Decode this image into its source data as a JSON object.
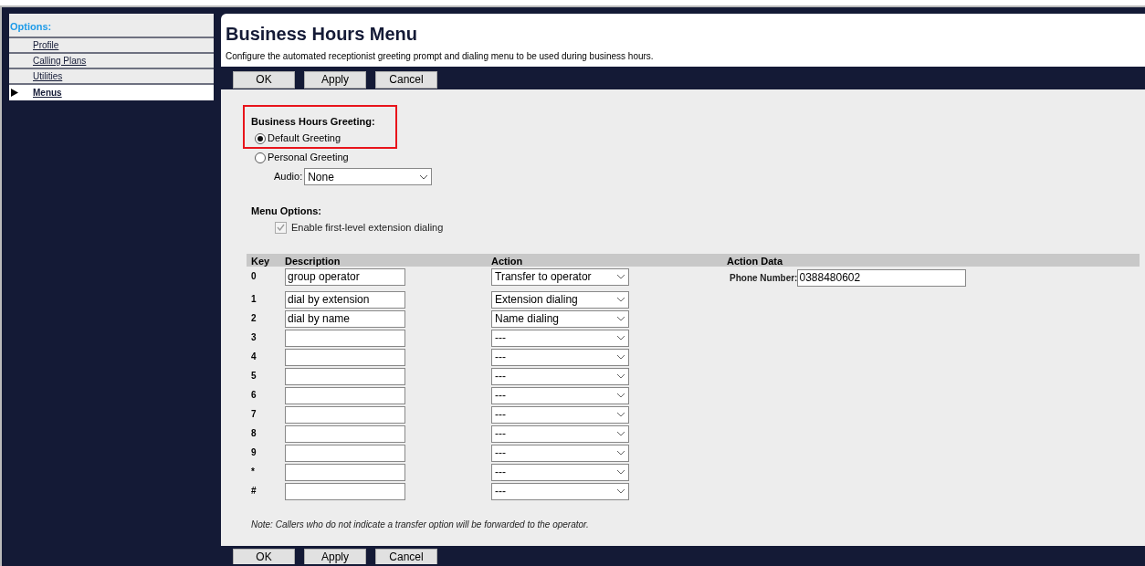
{
  "sidebar": {
    "heading": "Options:",
    "items": [
      {
        "label": "Profile",
        "selected": false
      },
      {
        "label": "Calling Plans",
        "selected": false
      },
      {
        "label": "Utilities",
        "selected": false
      },
      {
        "label": "Menus",
        "selected": true
      }
    ]
  },
  "page": {
    "title": "Business Hours Menu",
    "description": "Configure the automated receptionist greeting prompt and dialing menu to be used during business hours."
  },
  "toolbar": [
    "OK",
    "Apply",
    "Cancel"
  ],
  "greeting": {
    "heading": "Business Hours Greeting:",
    "options": [
      {
        "label": "Default Greeting",
        "selected": true
      },
      {
        "label": "Personal Greeting",
        "selected": false
      }
    ],
    "audio": {
      "label": "Audio:",
      "value": "None"
    }
  },
  "menu_options": {
    "heading": "Menu Options:",
    "checkbox": {
      "label": "Enable first-level extension dialing",
      "checked": true,
      "disabled": true
    }
  },
  "table": {
    "columns": [
      "Key",
      "Description",
      "Action",
      "Action Data"
    ],
    "rows": [
      {
        "key": "0",
        "description": "group operator",
        "action": "Transfer to operator",
        "action_data": {
          "label": "Phone Number:",
          "value": "0388480602"
        }
      },
      {
        "key": "1",
        "description": "dial by extension",
        "action": "Extension dialing"
      },
      {
        "key": "2",
        "description": "dial by name",
        "action": "Name dialing"
      },
      {
        "key": "3",
        "action": "---"
      },
      {
        "key": "4",
        "action": "---"
      },
      {
        "key": "5",
        "action": "---"
      },
      {
        "key": "6",
        "action": "---"
      },
      {
        "key": "7",
        "action": "---"
      },
      {
        "key": "8",
        "action": "---"
      },
      {
        "key": "9",
        "action": "---"
      },
      {
        "key": "*",
        "action": "---"
      },
      {
        "key": "#",
        "action": "---"
      }
    ]
  },
  "note": "Note: Callers who do not indicate a transfer option will be forwarded to the operator.",
  "bottom_toolbar": [
    "OK",
    "Apply",
    "Cancel"
  ]
}
